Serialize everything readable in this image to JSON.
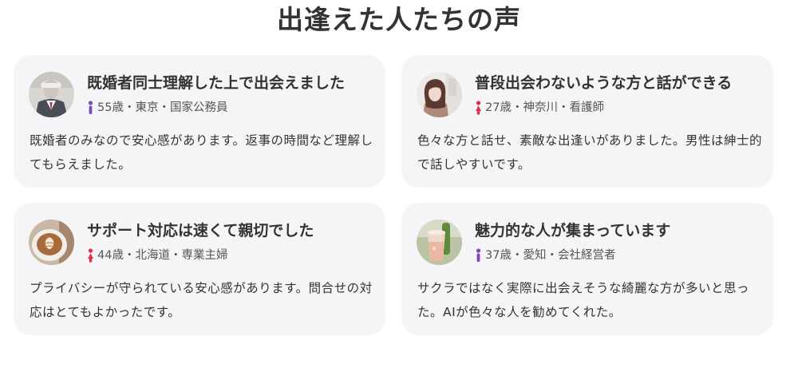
{
  "section": {
    "title": "出逢えた人たちの声"
  },
  "colors": {
    "card_bg": "#f5f5f8",
    "male_icon": "#7a4bb5",
    "female_icon": "#d9324a"
  },
  "testimonials": [
    {
      "title": "既婚者同士理解した上で出会えました",
      "gender_icon": "male-icon",
      "meta": "55歳・東京・国家公務員",
      "body": "既婚者のみなので安心感があります。返事の時間など理解してもらえました。",
      "avatar": "man-in-suit-avatar"
    },
    {
      "title": "普段出会わないような方と話ができる",
      "gender_icon": "female-icon",
      "meta": "27歳・神奈川・看護師",
      "body": "色々な方と話せ、素敵な出逢いがありました。男性は紳士的で話しやすいです。",
      "avatar": "woman-portrait-avatar"
    },
    {
      "title": "サポート対応は速くて親切でした",
      "gender_icon": "female-icon",
      "meta": "44歳・北海道・専業主婦",
      "body": "プライバシーが守られている安心感があります。問合せの対応はとてもよかったです。",
      "avatar": "latte-art-avatar"
    },
    {
      "title": "魅力的な人が集まっています",
      "gender_icon": "male-icon",
      "meta": "37歳・愛知・会社経営者",
      "body": "サクラではなく実際に出会えそうな綺麗な方が多いと思った。AIが色々な人を勧めてくれた。",
      "avatar": "drink-glass-avatar"
    }
  ]
}
